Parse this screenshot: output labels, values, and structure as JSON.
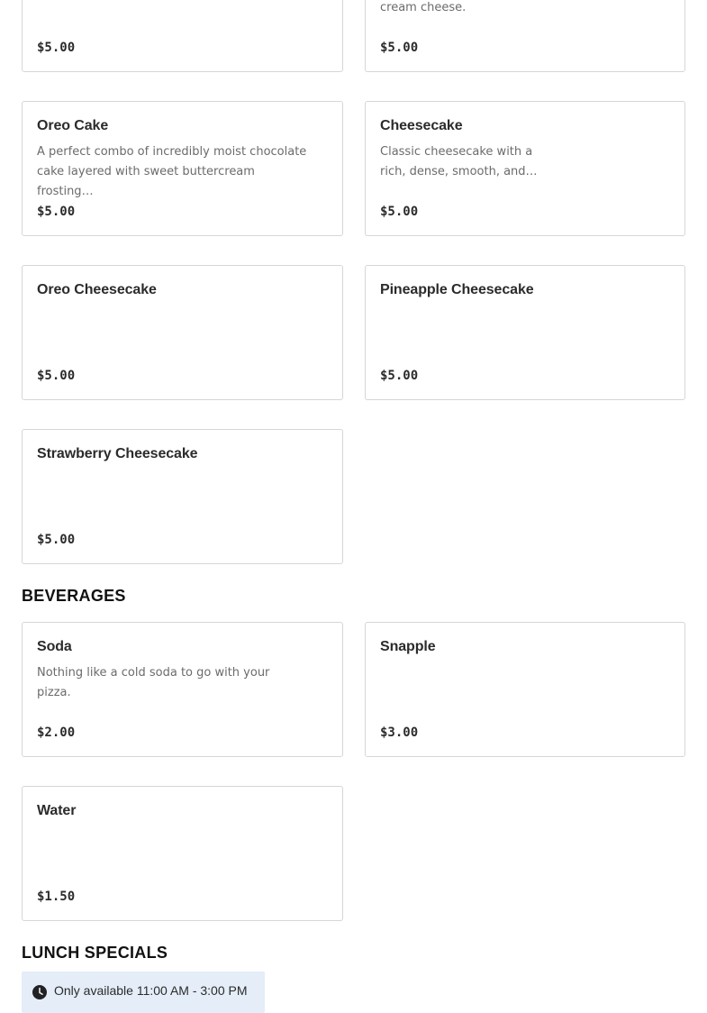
{
  "sections": {
    "beverages_title": "BEVERAGES",
    "lunch_title": "LUNCH SPECIALS"
  },
  "items": {
    "partial_left": {
      "price": "$5.00"
    },
    "partial_right": {
      "description": "cream cheese.",
      "price": "$5.00"
    },
    "oreo_cake": {
      "name": "Oreo Cake",
      "description": "A perfect combo of incredibly moist chocolate cake layered with sweet buttercream frosting…",
      "price": "$5.00"
    },
    "cheesecake": {
      "name": "Cheesecake",
      "description": "Classic cheesecake with a rich, dense, smooth, and…",
      "price": "$5.00"
    },
    "oreo_cheesecake": {
      "name": "Oreo Cheesecake",
      "price": "$5.00"
    },
    "pineapple_cheesecake": {
      "name": "Pineapple Cheesecake",
      "price": "$5.00"
    },
    "strawberry_cheesecake": {
      "name": "Strawberry Cheesecake",
      "price": "$5.00"
    },
    "soda": {
      "name": "Soda",
      "description": "Nothing like a cold soda to go with your pizza.",
      "price": "$2.00"
    },
    "snapple": {
      "name": "Snapple",
      "price": "$3.00"
    },
    "water": {
      "name": "Water",
      "price": "$1.50"
    }
  },
  "lunch_notice": {
    "icon": "clock-icon",
    "text": "Only available 11:00 AM - 3:00 PM",
    "background": "#e4edf8"
  },
  "colors": {
    "border": "#d6d6d6",
    "text": "#2b2b2b",
    "muted_text": "#6b6b6b"
  }
}
